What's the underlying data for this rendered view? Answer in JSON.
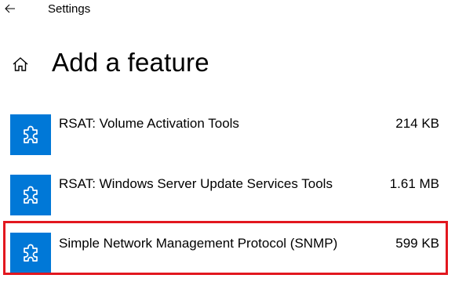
{
  "titlebar": {
    "back_icon": "back-arrow-icon",
    "app_title": "Settings"
  },
  "header": {
    "home_icon": "home-icon",
    "title": "Add a feature"
  },
  "features": [
    {
      "name": "RSAT: Volume Activation Tools",
      "size": "214 KB",
      "icon": "puzzle-piece-icon"
    },
    {
      "name": "RSAT: Windows Server Update Services Tools",
      "size": "1.61 MB",
      "icon": "puzzle-piece-icon"
    },
    {
      "name": "Simple Network Management Protocol (SNMP)",
      "size": "599 KB",
      "icon": "puzzle-piece-icon",
      "highlighted": true
    }
  ],
  "colors": {
    "accent": "#0078d7",
    "highlight": "#e2171f"
  }
}
